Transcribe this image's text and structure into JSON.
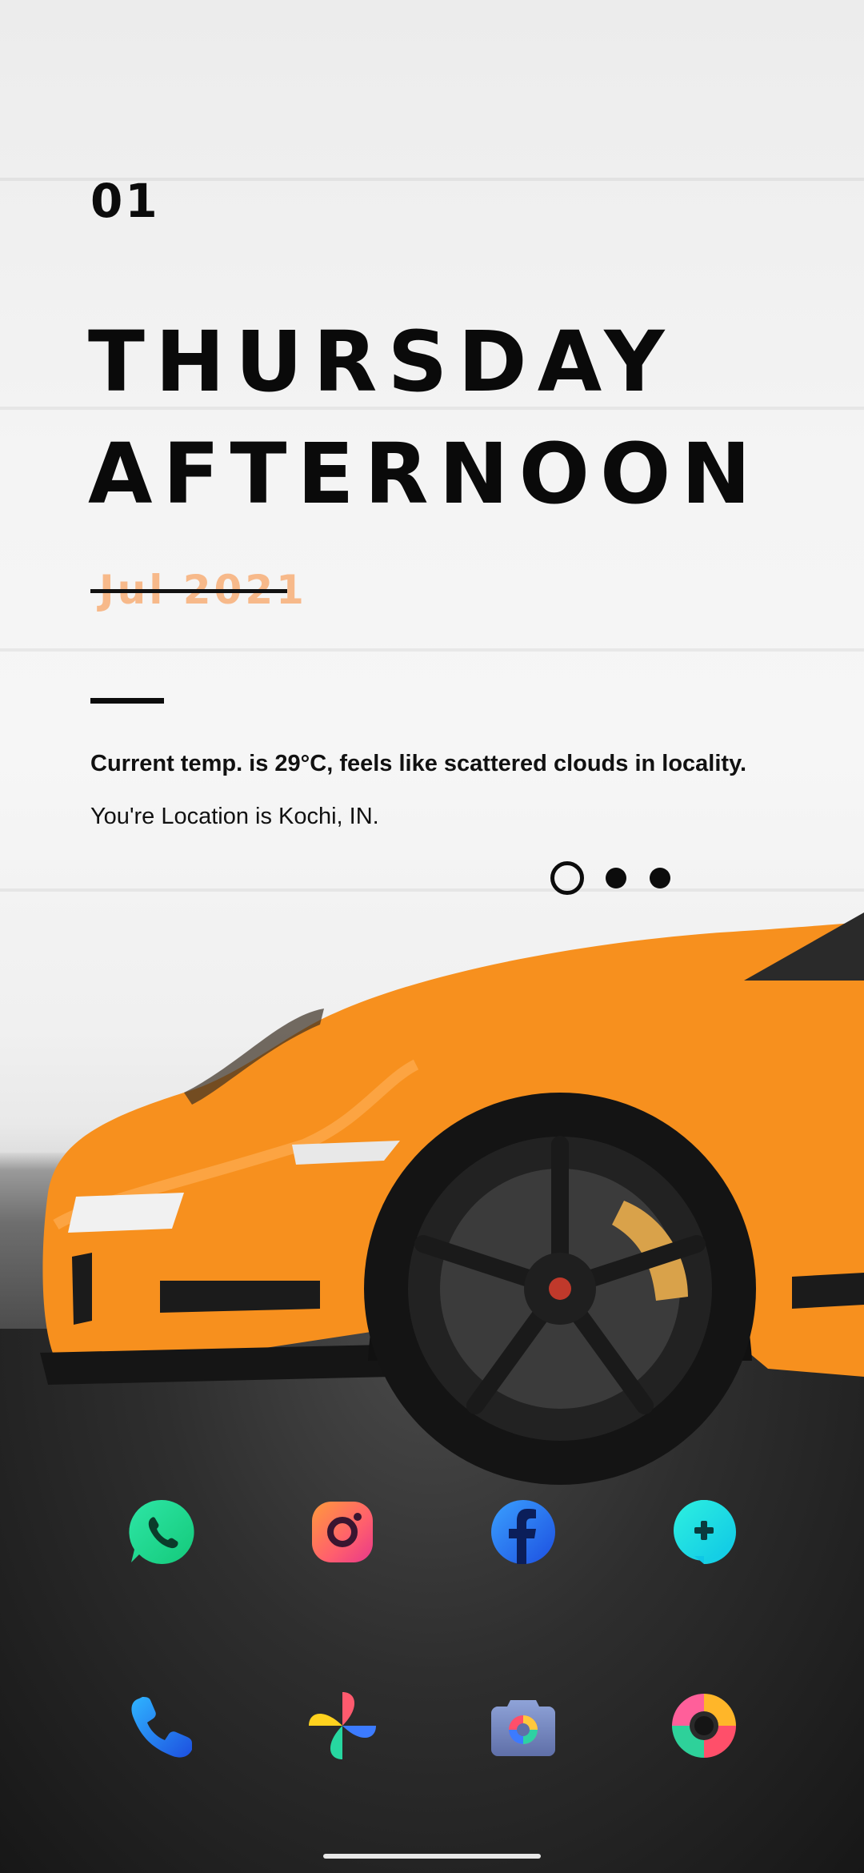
{
  "widget": {
    "day_number": "01",
    "line1": "THURSDAY",
    "line2": "AFTERNOON",
    "date": "Jul 2021",
    "weather_text": "Current temp. is 29°C, feels like scattered clouds in locality.",
    "location_text": "You're Location is Kochi, IN."
  },
  "pager": {
    "pages": 3,
    "current": 1
  },
  "apps": {
    "row1": [
      {
        "name": "whatsapp",
        "icon": "whatsapp-icon"
      },
      {
        "name": "instagram",
        "icon": "instagram-icon"
      },
      {
        "name": "facebook",
        "icon": "facebook-icon"
      },
      {
        "name": "messenger-plus",
        "icon": "chat-plus-icon"
      }
    ],
    "dock": [
      {
        "name": "phone",
        "icon": "phone-icon"
      },
      {
        "name": "photos",
        "icon": "pinwheel-icon"
      },
      {
        "name": "camera",
        "icon": "camera-icon"
      },
      {
        "name": "chrome",
        "icon": "chrome-icon"
      }
    ]
  },
  "colors": {
    "accent_orange": "#ff8c1a",
    "date_peach": "#f7b98a",
    "text_dark": "#0b0b0b"
  }
}
